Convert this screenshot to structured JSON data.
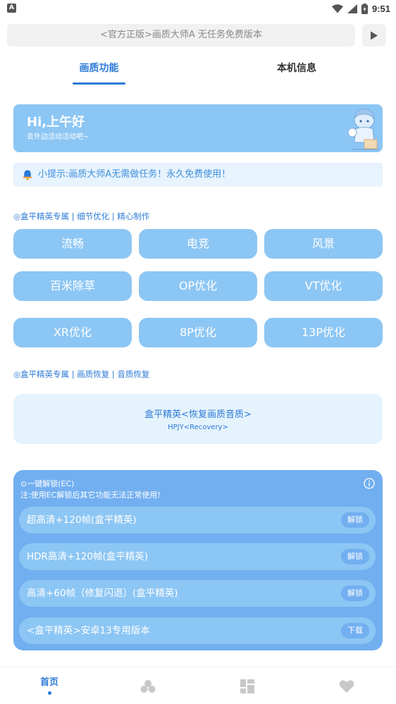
{
  "status_bar": {
    "app_badge": "A",
    "time": "9:51",
    "icons": [
      "wifi-icon",
      "signal-icon",
      "battery-icon"
    ]
  },
  "notice": {
    "text": "<官方正版>画质大师A 无任务免费版本",
    "play_icon": "play-icon"
  },
  "tabs": [
    {
      "label": "画质功能",
      "active": true
    },
    {
      "label": "本机信息",
      "active": false
    }
  ],
  "greeting": {
    "title": "Hi,上午好",
    "subtitle": "去外边活动活动吧~",
    "mascot_icon": "mascot-illustration"
  },
  "tip": {
    "icon": "bell-icon",
    "text": "小提示:画质大师A无需做任务！永久免费使用！"
  },
  "section_optimize": {
    "label": "◎盒平精英专属 | 细节优化 | 精心制作",
    "buttons": [
      "流畅",
      "电竞",
      "风景",
      "百米除草",
      "OP优化",
      "VT优化",
      "XR优化",
      "8P优化",
      "13P优化"
    ]
  },
  "section_recovery": {
    "label": "◎盒平精英专属 | 画质恢复 | 音质恢复",
    "card_title": "盒平精英<恢复画质音质>",
    "card_subtitle": "HPJY<Recovery>"
  },
  "unlock_panel": {
    "title": "⊙一键解锁(EC)",
    "note": "注:使用EC解锁后其它功能无法正常使用!",
    "info_icon": "info-icon",
    "rows": [
      {
        "label": "超高清+120帧(盒平精英)",
        "action": "解锁"
      },
      {
        "label": "HDR高清+120帧(盒平精英)",
        "action": "解锁"
      },
      {
        "label": "高清+60帧（修复闪退）(盒平精英)",
        "action": "解锁"
      },
      {
        "label": "<盒平精英>安卓13专用版本",
        "action": "下载"
      }
    ]
  },
  "bottom_nav": {
    "home_label": "首页",
    "icons": [
      "home-icon",
      "circles-icon",
      "grid-icon",
      "heart-icon"
    ]
  },
  "colors": {
    "accent": "#2c7ad6",
    "card_blue": "#8cc6f4",
    "panel_blue": "#72aff0",
    "light_blue": "#e5f3fd"
  }
}
